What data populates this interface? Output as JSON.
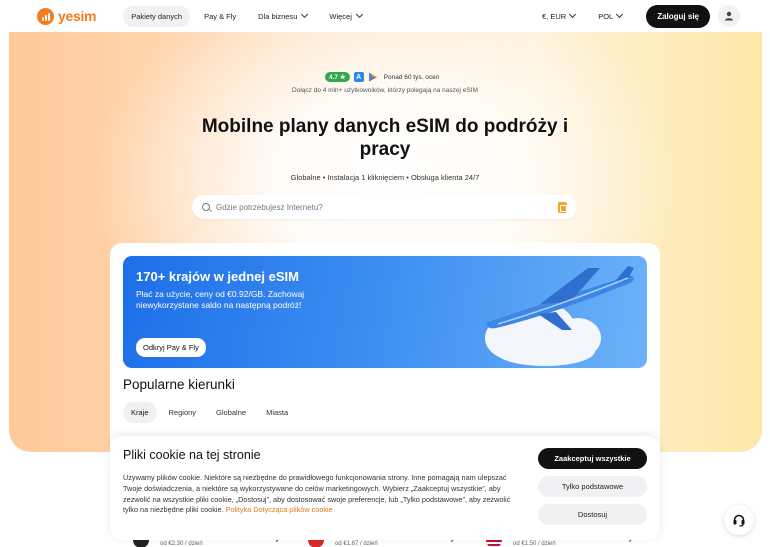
{
  "header": {
    "logo_text": "yesim",
    "nav": [
      {
        "label": "Pakiety danych",
        "active": true
      },
      {
        "label": "Pay & Fly"
      },
      {
        "label": "Dla biznesu",
        "dropdown": true
      },
      {
        "label": "Więcej",
        "dropdown": true
      }
    ],
    "currency": "€, EUR",
    "language": "POL",
    "login_label": "Zaloguj się"
  },
  "hero": {
    "rating_score": "4.7 ★",
    "rating_text": "Ponad 60 tys. ocen",
    "subtext": "Dołącz do 4 mln+ użytkowników, którzy polegają na naszej eSIM",
    "title": "Mobilne plany danych eSIM do podróży i pracy",
    "features": "Globalne • Instalacja 1 kliknięciem • Obsługa klienta 24/7",
    "search_placeholder": "Gdzie potrzebujesz Internetu?"
  },
  "banner": {
    "title": "170+ krajów w jednej eSIM",
    "text": "Płać za użycie, ceny od €0.92/GB. Zachowaj niewykorzystane saldo na następną podróż!",
    "button_label": "Odkryj Pay & Fly"
  },
  "popular": {
    "heading": "Popularne kierunki",
    "tabs": [
      {
        "label": "Kraje",
        "active": true
      },
      {
        "label": "Regiony"
      },
      {
        "label": "Globalne"
      },
      {
        "label": "Miasta"
      }
    ],
    "peek_items": [
      {
        "price": "od €2.30 / dzień"
      },
      {
        "price": "od €1.87 / dzień"
      },
      {
        "price": "od €1.50 / dzień"
      }
    ]
  },
  "cookie": {
    "title": "Pliki cookie na tej stronie",
    "text": "Używamy plików cookie. Niektóre są niezbędne do prawidłowego funkcjonowania strony. Inne pomagają nam ulepszać Twoje doświadczenia, a niektóre są wykorzystywane do celów marketingowych. Wybierz „Zaakceptuj wszystkie”, aby zezwolić na wszystkie pliki cookie, „Dostosuj”, aby dostosować swoje preferencje, lub „Tylko podstawowe”, aby zezwolić tylko na niezbędne pliki cookie.",
    "link_text": "Polityka Dotycząca plików cookie",
    "accept_all": "Zaakceptuj wszystkie",
    "essential_only": "Tylko podstawowe",
    "customize": "Dostosuj"
  },
  "colors": {
    "brand": "#f47c20",
    "dark": "#111111",
    "banner_blue": "#1e6fe8",
    "rating_green": "#2faa4a"
  }
}
